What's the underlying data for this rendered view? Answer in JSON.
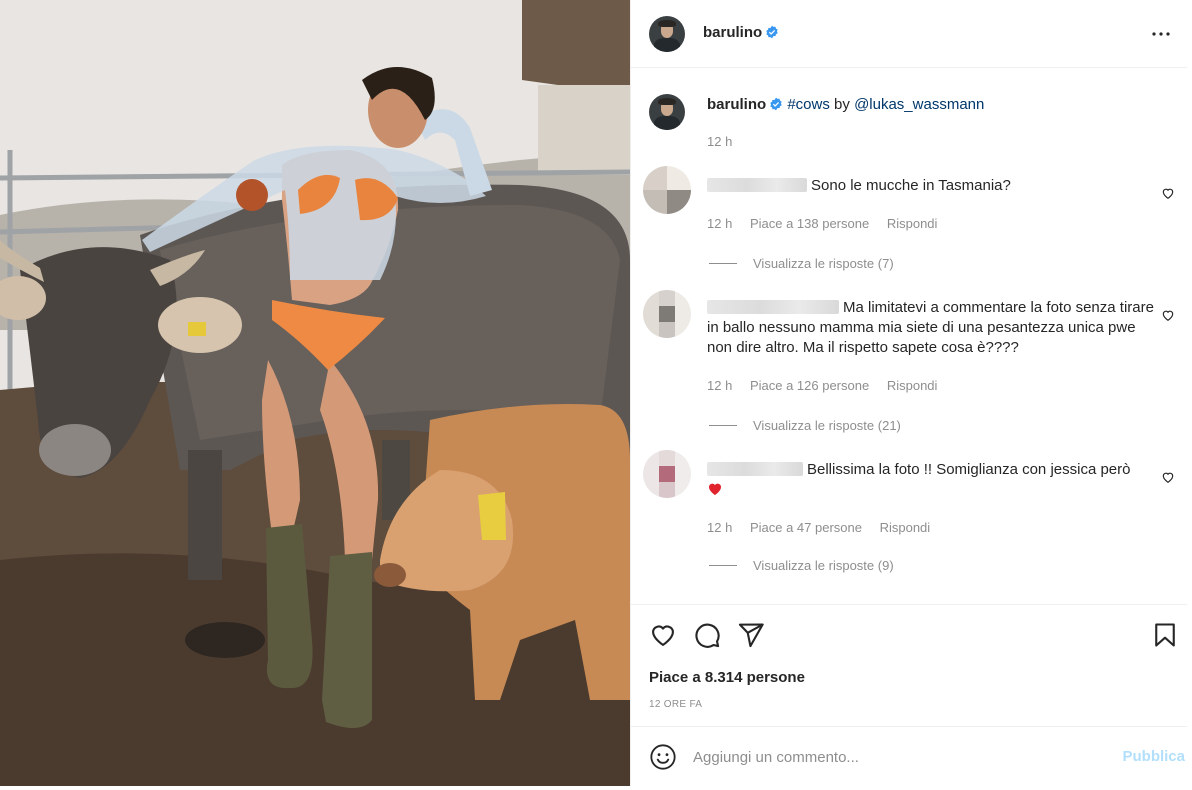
{
  "post": {
    "author": "barulino",
    "verified": true,
    "caption": {
      "tag": "#cows",
      "by": "by",
      "mention": "@lukas_wassmann"
    },
    "caption_time": "12 h"
  },
  "comments": [
    {
      "text": "Sono le mucche in Tasmania?",
      "time": "12 h",
      "likes": "Piace a 138 persone",
      "reply": "Rispondi",
      "replies": "Visualizza le risposte (7)"
    },
    {
      "text": "Ma limitatevi a commentare la foto senza tirare in ballo nessuno mamma mia siete di una pesantezza unica pwe non dire altro. Ma il rispetto sapete cosa è????",
      "time": "12 h",
      "likes": "Piace a 126 persone",
      "reply": "Rispondi",
      "replies": "Visualizza le risposte (21)"
    },
    {
      "text": "Bellissima la foto !! Somiglianza con jessica però",
      "time": "12 h",
      "likes": "Piace a 47 persone",
      "reply": "Rispondi",
      "replies": "Visualizza le risposte (9)"
    }
  ],
  "actions": {
    "likes_count": "Piace a 8.314 persone",
    "time_ago": "12 ORE FA"
  },
  "composer": {
    "placeholder": "Aggiungi un commento...",
    "publish_label": "Pubblica"
  },
  "colors": {
    "link": "#00376b",
    "verified": "#3897f0",
    "muted": "#8e8e8e",
    "publish_disabled": "#b2dffc",
    "heart_red": "#ed4956"
  },
  "icons": [
    "verified-badge-icon",
    "more-options-icon",
    "like-icon",
    "comment-icon",
    "share-icon",
    "save-icon",
    "emoji-icon",
    "comment-like-icon",
    "red-heart-emoji"
  ]
}
